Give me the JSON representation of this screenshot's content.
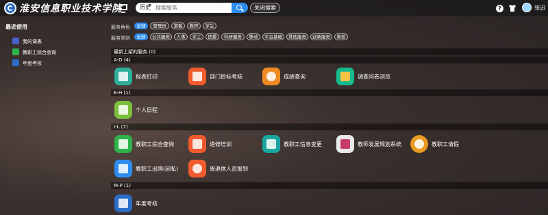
{
  "header": {
    "school_name": "淮安信息职业技术学院",
    "search_scope": "历史",
    "search_placeholder": "搜索服务",
    "close_search_label": "关闭搜索",
    "help_symbol": "?",
    "username": "张迅"
  },
  "sidebar": {
    "title": "最近使用",
    "items": [
      {
        "label": "我的课表",
        "color": "#4a63c9"
      },
      {
        "label": "教职工综合查询",
        "color": "#2db34a"
      },
      {
        "label": "年度考核",
        "color": "#2b6cc4"
      }
    ]
  },
  "filters": {
    "role_label": "服务角色",
    "roles": [
      "全部",
      "管理员",
      "游客",
      "教师",
      "学生"
    ],
    "category_label": "服务类别",
    "categories": [
      "全部",
      "公共服务",
      "人事",
      "学工",
      "团委",
      "科研服务",
      "移动",
      "平台基础",
      "其他服务",
      "迎新服务",
      "离校"
    ]
  },
  "sections": [
    {
      "title": "最新上架的服务 (0)"
    },
    {
      "title": "A-D (4)",
      "items": [
        {
          "label": "报表打印",
          "color": "#2fae9a"
        },
        {
          "label": "部门目标考核",
          "color": "#ef5b2c"
        },
        {
          "label": "成绩查询",
          "color": "#f08a24"
        },
        {
          "label": "调查问卷浏览",
          "color": "#16b98c"
        }
      ]
    },
    {
      "title": "E-H (1)",
      "items": [
        {
          "label": "个人日程",
          "color": "#7bbf3b"
        }
      ]
    },
    {
      "title": "I-L (7)",
      "items": [
        {
          "label": "教职工综合查询",
          "color": "#2db34a"
        },
        {
          "label": "进修培训",
          "color": "#ef5b2c"
        },
        {
          "label": "教职工信息变更",
          "color": "#1aa6a0"
        },
        {
          "label": "教师发展规划系统",
          "color": "#e8e8e8"
        },
        {
          "label": "教职工请假",
          "color": "#e89a22"
        },
        {
          "label": "教职工出国(因私)",
          "color": "#2d8cf0"
        },
        {
          "label": "离退休人员报到",
          "color": "#ef5b2c"
        }
      ]
    },
    {
      "title": "M-P (1)",
      "items": [
        {
          "label": "年度考核",
          "color": "#2b6cc4"
        }
      ]
    }
  ]
}
